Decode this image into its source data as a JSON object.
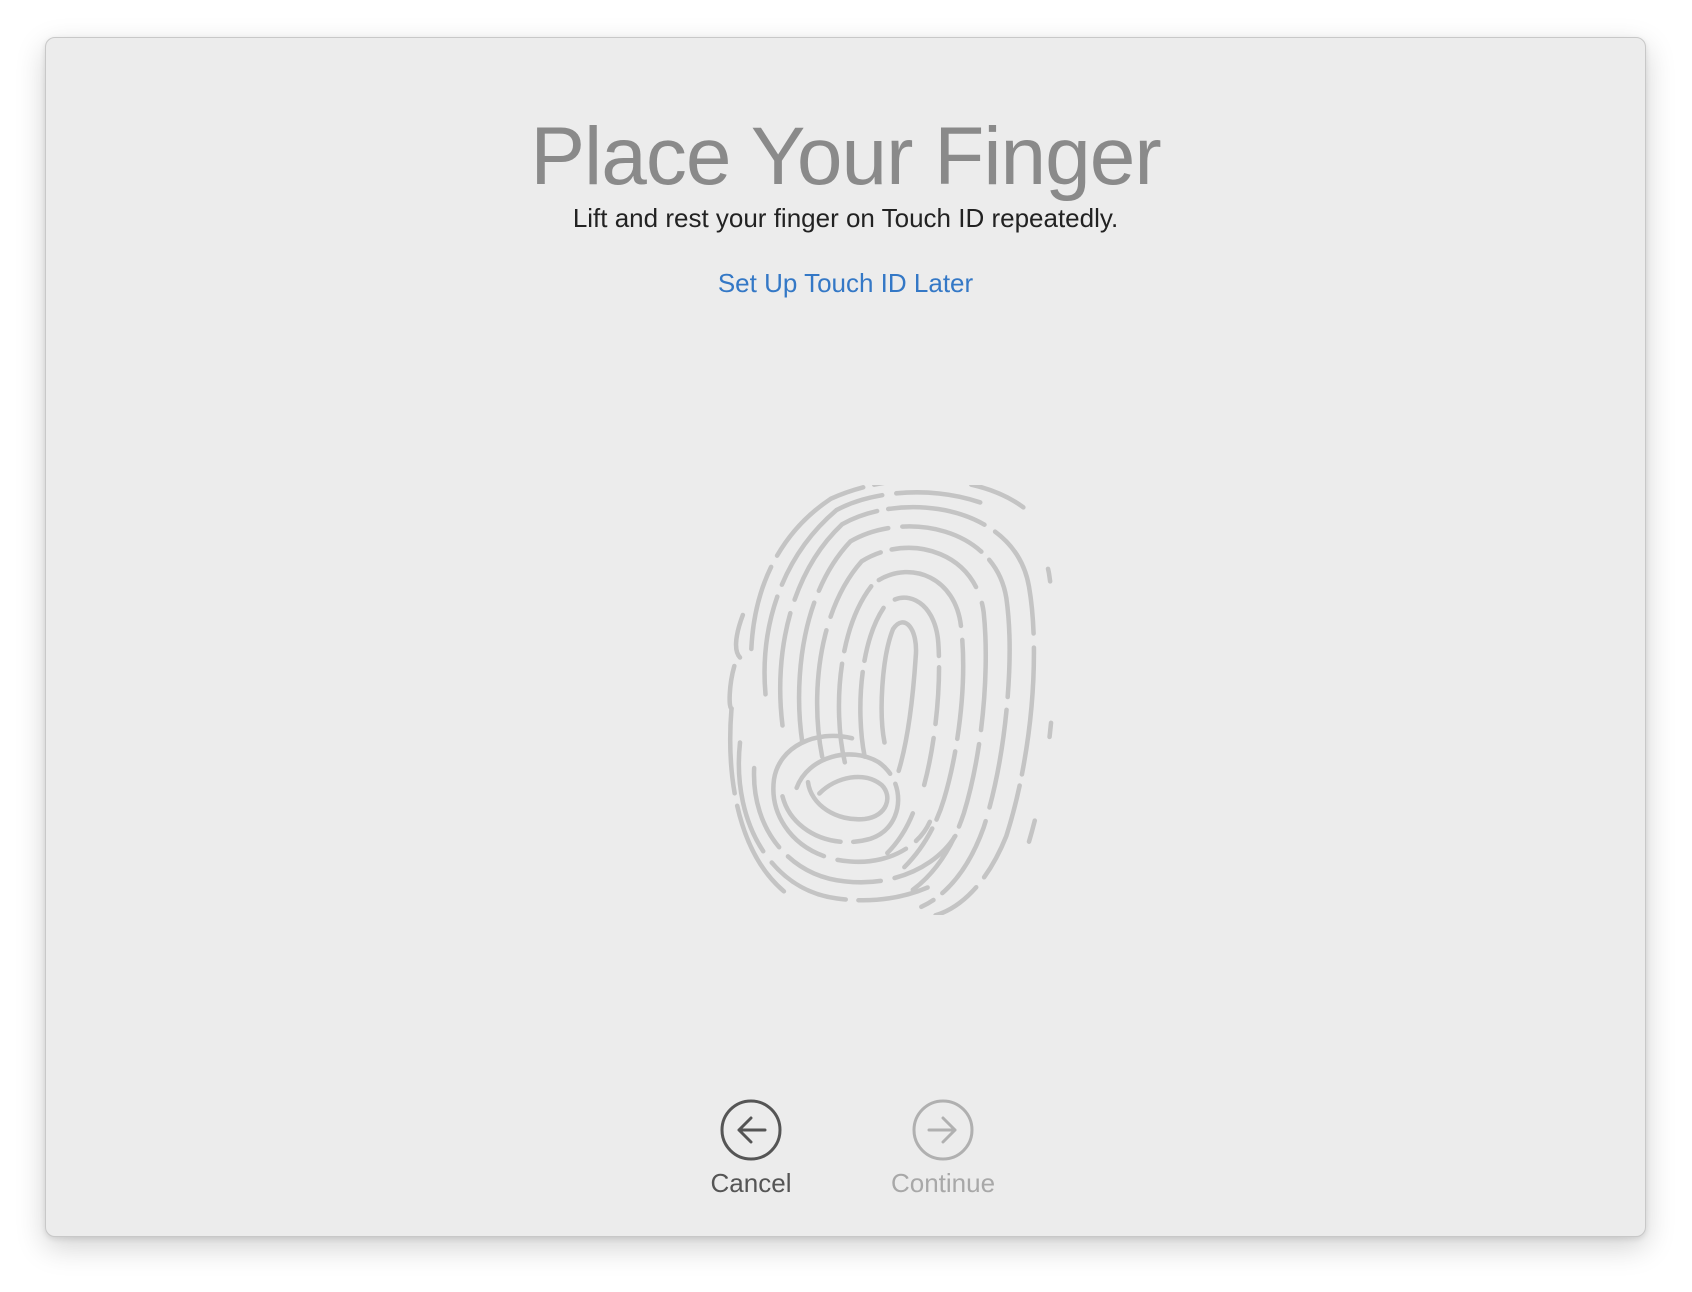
{
  "window": {
    "title": "Place Your Finger",
    "subtitle": "Lift and rest your finger on Touch ID repeatedly.",
    "later_link": "Set Up Touch ID Later"
  },
  "graphic": {
    "icon": "fingerprint-icon"
  },
  "nav": {
    "cancel_label": "Cancel",
    "cancel_icon": "arrow-left-circle-icon",
    "continue_label": "Continue",
    "continue_icon": "arrow-right-circle-icon",
    "continue_enabled": false
  },
  "colors": {
    "background": "#ececec",
    "title": "#8a8a8a",
    "link": "#3478c6",
    "fingerprint": "#c4c4c4",
    "disabled": "#a8a8a8"
  }
}
